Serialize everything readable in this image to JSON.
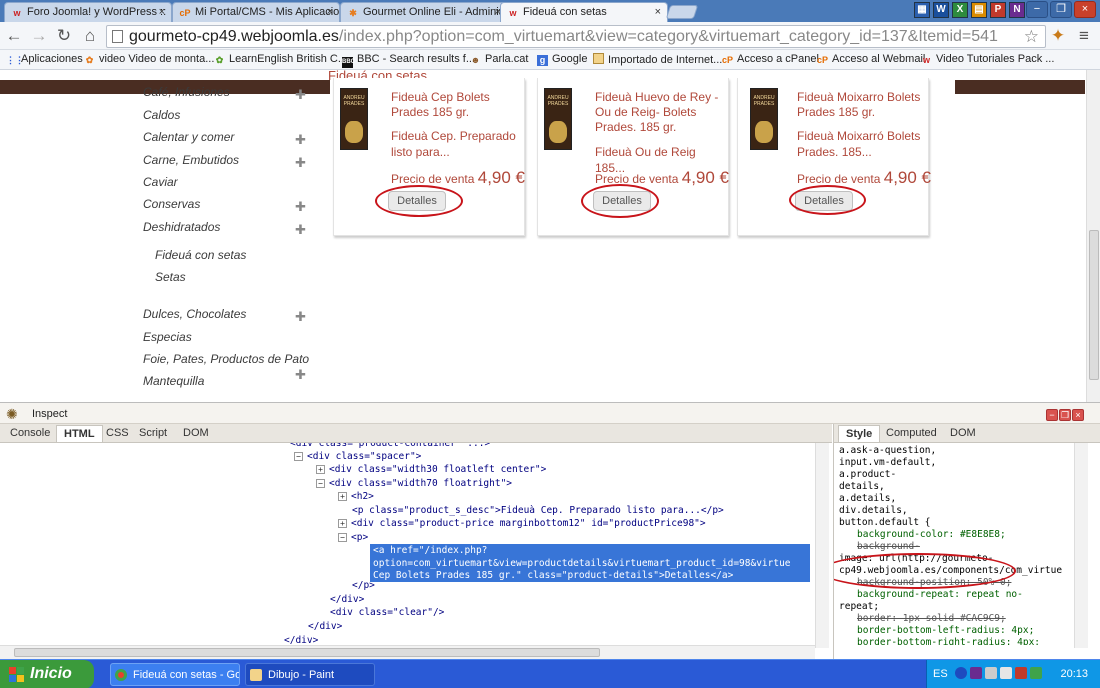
{
  "browser": {
    "tabs": [
      {
        "title": "Foro Joomla! y WordPress ::",
        "icon": "joomla-forum-icon",
        "active": false
      },
      {
        "title": "Mi Portal/CMS - Mis Aplicacio",
        "icon": "cpanel-icon",
        "active": false
      },
      {
        "title": "Gourmet Online Eli - Administ",
        "icon": "joomla-admin-icon",
        "active": false
      },
      {
        "title": "Fideuá con setas",
        "icon": "joomla-site-icon",
        "active": true
      }
    ],
    "url_host": "gourmeto-cp49.webjoomla.es",
    "url_path": "/index.php?option=com_virtuemart&view=category&virtuemart_category_id=137&Itemid=541",
    "bookmarks": [
      {
        "label": "Aplicaciones",
        "icon": "apps-grid-icon"
      },
      {
        "label": "video Video de monta...",
        "icon": "video-site-icon"
      },
      {
        "label": "LearnEnglish British C...",
        "icon": "learnenglish-icon"
      },
      {
        "label": "BBC - Search results f...",
        "icon": "bbc-icon"
      },
      {
        "label": "Parla.cat",
        "icon": "parla-icon"
      },
      {
        "label": "Google",
        "icon": "google-icon"
      },
      {
        "label": "Importado de Internet...",
        "icon": "folder-icon"
      },
      {
        "label": "Acceso a cPanel",
        "icon": "cpanel-icon"
      },
      {
        "label": "Acceso al Webmail",
        "icon": "cpanel-icon"
      },
      {
        "label": "Video Tutoriales Pack ...",
        "icon": "joomla-icon"
      }
    ]
  },
  "page": {
    "category_title": "Fideuá con setas",
    "categories": [
      {
        "label": "Café, Infusiones",
        "expandable": true
      },
      {
        "label": "Caldos",
        "expandable": false
      },
      {
        "label": "Calentar y comer",
        "expandable": true
      },
      {
        "label": "Carne, Embutidos",
        "expandable": true
      },
      {
        "label": "Caviar",
        "expandable": false
      },
      {
        "label": "Conservas",
        "expandable": true
      },
      {
        "label": "Deshidratados",
        "expandable": true
      },
      {
        "label": "Fideuá con setas",
        "expandable": false,
        "sub": true
      },
      {
        "label": "Setas",
        "expandable": false,
        "sub": true
      },
      {
        "label": "Dulces, Chocolates",
        "expandable": true
      },
      {
        "label": "Especias",
        "expandable": false
      },
      {
        "label": "Foie, Pates, Productos de Pato",
        "expandable": false
      },
      {
        "label": "Mantequilla",
        "expandable": true
      }
    ],
    "products": [
      {
        "name": "Fideuà Cep Bolets Prades 185 gr.",
        "desc": "Fideuà Cep. Preparado listo para...",
        "price_label": "Precio de venta",
        "price": "4,90 €",
        "button": "Detalles",
        "brand": "ANDREU PRADES"
      },
      {
        "name": "Fideuà Huevo de Rey - Ou de Reig- Bolets Prades. 185 gr.",
        "desc": "Fideuà Ou de Reig 185...",
        "price_label": "Precio de venta",
        "price": "4,90 €",
        "button": "Detalles",
        "brand": "ANDREU PRADES"
      },
      {
        "name": "Fideuà Moixarro Bolets Prades 185 gr.",
        "desc": "Fideuà Moixarró Bolets Prades. 185...",
        "price_label": "Precio de venta",
        "price": "4,90 €",
        "button": "Detalles",
        "brand": "ANDREU PRADES"
      }
    ]
  },
  "firebug": {
    "inspect_label": "Inspect",
    "tabs": [
      "Console",
      "HTML",
      "CSS",
      "Script",
      "DOM"
    ],
    "active_tab": "HTML",
    "side_tabs": [
      "Style",
      "Computed",
      "DOM"
    ],
    "active_side_tab": "Style",
    "html_lines": [
      {
        "indent": 290,
        "twisty": "",
        "text": "<div class=\"product-container\" ...>"
      },
      {
        "indent": 294,
        "twisty": "−",
        "text": "<div class=\"spacer\">"
      },
      {
        "indent": 316,
        "twisty": "+",
        "text": "<div class=\"width30 floatleft center\">"
      },
      {
        "indent": 316,
        "twisty": "−",
        "text": "<div class=\"width70 floatright\">"
      },
      {
        "indent": 338,
        "twisty": "+",
        "text": "<h2>"
      },
      {
        "indent": 352,
        "twisty": "",
        "text": "<p class=\"product_s_desc\">Fideuà Cep. Preparado listo para...</p>"
      },
      {
        "indent": 338,
        "twisty": "+",
        "text": "<div class=\"product-price marginbottom12\" id=\"productPrice98\">"
      },
      {
        "indent": 338,
        "twisty": "−",
        "text": "<p>"
      },
      {
        "indent": 352,
        "twisty": "",
        "text": "</p>"
      },
      {
        "indent": 330,
        "twisty": "",
        "text": "</div>"
      },
      {
        "indent": 330,
        "twisty": "",
        "text": "<div class=\"clear\"/>"
      },
      {
        "indent": 308,
        "twisty": "",
        "text": "</div>"
      },
      {
        "indent": 284,
        "twisty": "",
        "text": "</div>"
      }
    ],
    "selected_html": "<a href=\"/index.php?\noption=com_virtuemart&view=productdetails&virtuemart_product_id=98&virtue\nCep Bolets Prades 185 gr.\" class=\"product-details\">Detalles</a>",
    "style_lines": [
      {
        "kind": "sel",
        "text": "a.ask-a-question,"
      },
      {
        "kind": "sel",
        "text": "input.vm-default,"
      },
      {
        "kind": "sel",
        "text": "a.product-"
      },
      {
        "kind": "sel",
        "text": "details,"
      },
      {
        "kind": "sel",
        "text": "a.details,"
      },
      {
        "kind": "sel",
        "text": "div.details,"
      },
      {
        "kind": "sel",
        "text": "button.default {"
      },
      {
        "kind": "prop",
        "text": "background-color: #E8E8E8;"
      },
      {
        "kind": "strike",
        "text": "background-"
      },
      {
        "kind": "sel",
        "text": "image: url(http://gourmeto-"
      },
      {
        "kind": "sel",
        "text": "cp49.webjoomla.es/components/com_virtue"
      },
      {
        "kind": "strike",
        "text": "background-position: 50% 0;"
      },
      {
        "kind": "prop",
        "text": "background-repeat: repeat no-"
      },
      {
        "kind": "sel",
        "text": "repeat;"
      },
      {
        "kind": "strike",
        "text": "border: 1px solid #CAC9C9;"
      },
      {
        "kind": "prop",
        "text": "border-bottom-left-radius: 4px;"
      },
      {
        "kind": "prop",
        "text": "border-bottom-right-radius: 4px;"
      }
    ]
  },
  "taskbar": {
    "start_label": "Inicio",
    "buttons": [
      {
        "label": "Fideuá con setas - Go...",
        "icon": "chrome-icon"
      },
      {
        "label": "Dibujo - Paint",
        "icon": "paint-icon"
      }
    ],
    "language": "ES",
    "clock": "20:13"
  },
  "colors": {
    "accent_red": "#b0483a",
    "annotation_red": "#c8141a",
    "selection_blue": "#3875d7",
    "taskbar_blue": "#2a5ad6"
  }
}
